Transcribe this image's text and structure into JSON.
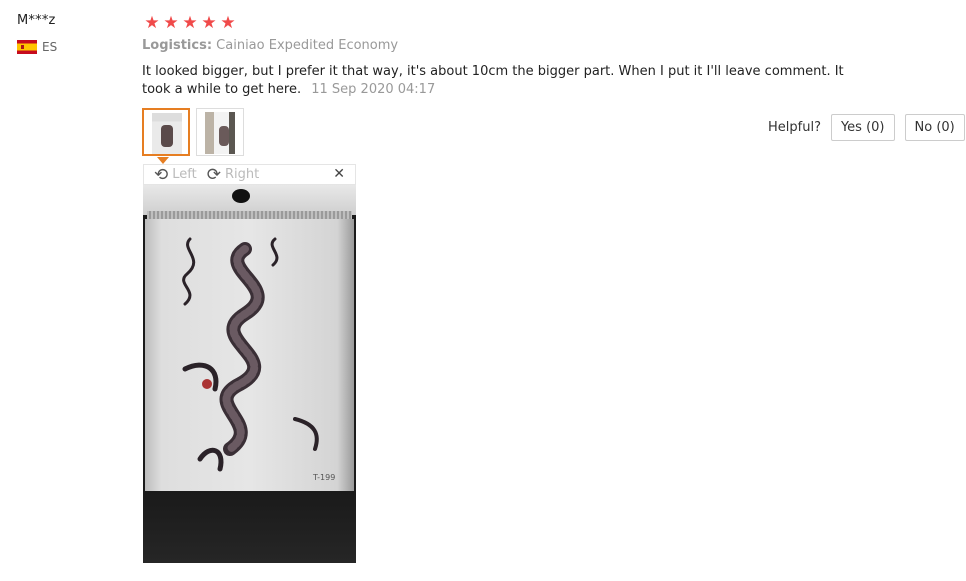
{
  "reviewer": {
    "name": "M***z",
    "country_code": "ES"
  },
  "rating": {
    "stars": 5,
    "max": 5,
    "star_color": "#f04a4a"
  },
  "logistics": {
    "label": "Logistics:",
    "value": "Cainiao Expedited Economy"
  },
  "review": {
    "text": "It looked bigger, but I prefer it that way, it's about 10cm the bigger part. When I put it I'll leave comment. It took a while to get here.",
    "date": "11 Sep 2020 04:17"
  },
  "thumbnails": [
    {
      "name": "review-photo-1",
      "selected": true
    },
    {
      "name": "review-photo-2",
      "selected": false
    }
  ],
  "viewer": {
    "rotate_left_label": "Left",
    "rotate_right_label": "Right",
    "rotate_left_icon": "rotate-left-icon",
    "rotate_right_icon": "rotate-right-icon",
    "close_icon": "close-icon",
    "photo_code": "T-199"
  },
  "helpful": {
    "label": "Helpful?",
    "yes_label": "Yes (0)",
    "no_label": "No (0)"
  },
  "colors": {
    "accent": "#e67e22",
    "muted_text": "#999999"
  }
}
